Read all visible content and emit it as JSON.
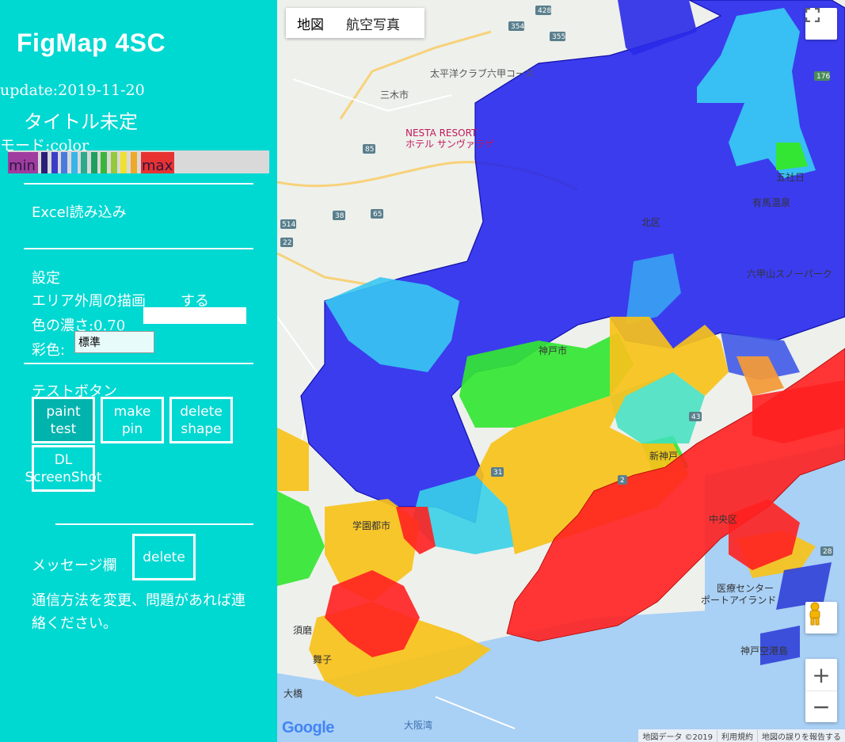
{
  "app": {
    "title": "FigMap 4SC",
    "update": "update:2019-11-20",
    "doc_title": "タイトル未定",
    "mode": "モード:color"
  },
  "legend": {
    "min_label": "min",
    "max_label": "max",
    "colors": [
      "#a03ca0",
      "#2c1e78",
      "#3c3cc8",
      "#4a7adc",
      "#3ab4e8",
      "#2caa8c",
      "#1fa060",
      "#3cb43c",
      "#96c83c",
      "#f0e030",
      "#f0a828",
      "#e83232"
    ]
  },
  "excel": {
    "label": "Excel読み込み"
  },
  "settings": {
    "heading": "設定",
    "outline_label": "エリア外周の描画",
    "outline_value": "する",
    "opacity_label": "色の濃さ:0.70",
    "coloring_label": "彩色:",
    "coloring_value": "標準"
  },
  "test": {
    "heading": "テストボタン",
    "paint_line1": "paint",
    "paint_line2": "test",
    "pin_line1": "make",
    "pin_line2": "pin",
    "delete_line1": "delete",
    "delete_line2": "shape",
    "dl_line1": "DL",
    "dl_line2": "ScreenShot"
  },
  "message": {
    "label": "メッセージ欄",
    "delete_label": "delete",
    "text_line1": "通信方法を変更、問題があれば連",
    "text_line2": "絡ください。"
  },
  "map": {
    "type_map": "地図",
    "type_aerial": "航空写真",
    "attribution": [
      "地図データ ©2019",
      "利用規約",
      "地図の誤りを報告する"
    ],
    "google": "Google",
    "zoom_in": "+",
    "zoom_out": "−",
    "labels": {
      "miki": "三木市",
      "golf": "太平洋クラブ六甲コース",
      "nesta1": "NESTA RESORT",
      "nesta2": "ホテル サンヴァラゲ",
      "kobe": "神戸市",
      "rokko": "六甲山スノーパーク",
      "kita": "北区",
      "gotai": "五社日",
      "arima": "有馬温泉",
      "chuo": "中央区",
      "shinkobe": "新神戸",
      "gakuen": "学園都市",
      "airport": "神戸空港島",
      "suma": "須磨",
      "maiko": "舞子",
      "akashi": "大阪湾",
      "ohashi": "大橋",
      "iryo": "医療センター",
      "portisland": "ポートアイランド"
    },
    "road_numbers": [
      "428",
      "354",
      "355",
      "176",
      "85",
      "38",
      "514",
      "22",
      "65",
      "31",
      "28",
      "2",
      "43"
    ]
  }
}
